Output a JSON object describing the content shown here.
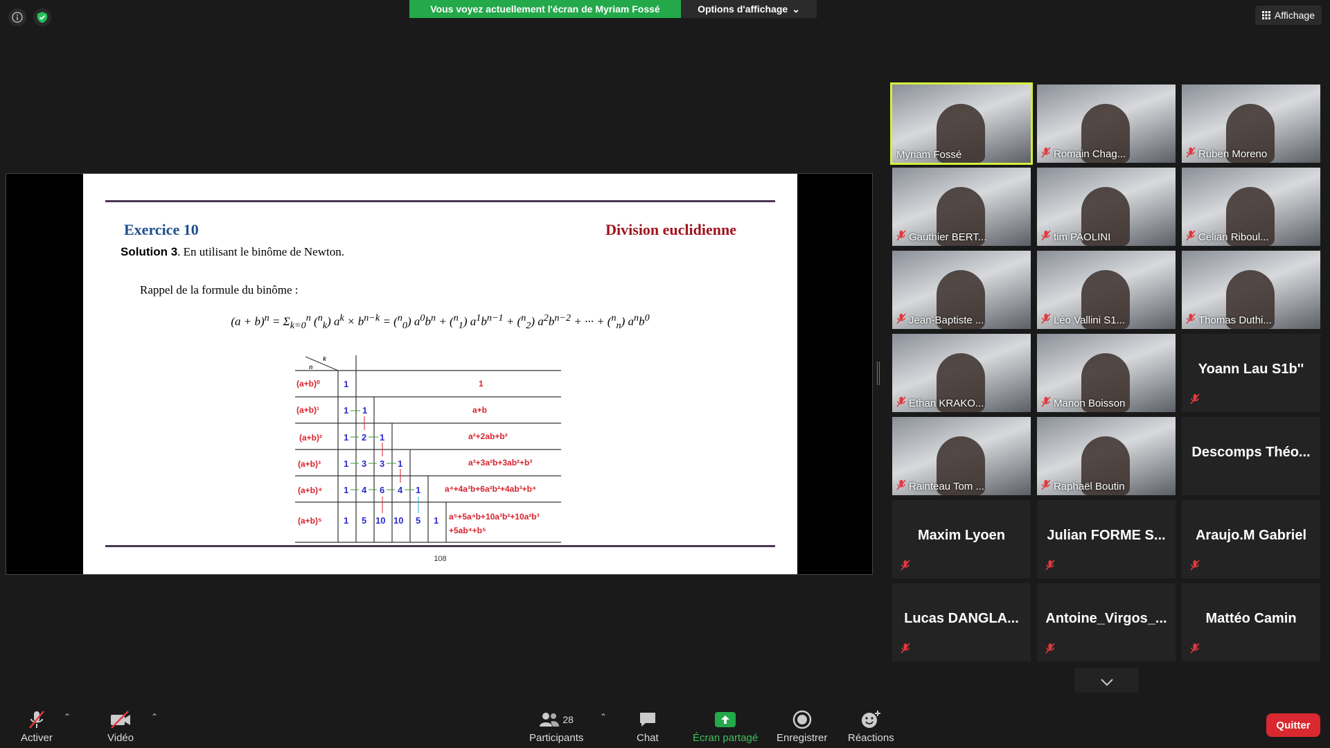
{
  "top": {
    "sharing_banner": "Vous voyez actuellement l'écran de Myriam Fossé",
    "view_options": "Options d'affichage",
    "view_button": "Affichage"
  },
  "slide": {
    "exercise_title": "Exercice 10",
    "exercise_topic": "Division euclidienne",
    "solution_label": "Solution 3",
    "solution_text": ". En utilisant le binôme de Newton.",
    "rappel": "Rappel de la formule du binôme :",
    "page_number": "108"
  },
  "gallery": {
    "tiles": [
      {
        "name": "Myriam Fossé",
        "type": "video",
        "muted": false,
        "active": true
      },
      {
        "name": "Romain Chag...",
        "type": "video",
        "muted": true
      },
      {
        "name": "Ruben Moreno",
        "type": "video",
        "muted": true
      },
      {
        "name": "Gauthier BERT...",
        "type": "video",
        "muted": true
      },
      {
        "name": "tim PAOLINI",
        "type": "video",
        "muted": true
      },
      {
        "name": "Celian Riboul...",
        "type": "video",
        "muted": true
      },
      {
        "name": "Jean-Baptiste ...",
        "type": "video",
        "muted": true
      },
      {
        "name": "Léo Vallini S1...",
        "type": "video",
        "muted": true
      },
      {
        "name": "Thomas Duthi...",
        "type": "video",
        "muted": true
      },
      {
        "name": "Ethan KRAKO...",
        "type": "video",
        "muted": true
      },
      {
        "name": "Manon Boisson",
        "type": "video",
        "muted": true
      },
      {
        "name": "Yoann Lau S1b''",
        "type": "name",
        "muted": true
      },
      {
        "name": "Rainteau Tom ...",
        "type": "video",
        "muted": true
      },
      {
        "name": "Raphaël Boutin",
        "type": "video",
        "muted": true
      },
      {
        "name": "Descomps Théo...",
        "type": "name",
        "muted": false
      },
      {
        "name": "Maxim Lyoen",
        "type": "name",
        "muted": true
      },
      {
        "name": "Julian FORME S...",
        "type": "name",
        "muted": true
      },
      {
        "name": "Araujo.M Gabriel",
        "type": "name",
        "muted": true
      },
      {
        "name": "Lucas DANGLA...",
        "type": "name",
        "muted": true
      },
      {
        "name": "Antoine_Virgos_...",
        "type": "name",
        "muted": true
      },
      {
        "name": "Mattéo Camin",
        "type": "name",
        "muted": true
      }
    ]
  },
  "toolbar": {
    "unmute": "Activer",
    "video": "Vidéo",
    "participants": "Participants",
    "participants_count": "28",
    "chat": "Chat",
    "share": "Écran partagé",
    "record": "Enregistrer",
    "reactions": "Réactions",
    "quit": "Quitter"
  },
  "colors": {
    "share_green": "#23a84a",
    "active_speaker": "#d6ef3c",
    "quit_red": "#d9282f",
    "muted_red": "#e0393e"
  }
}
